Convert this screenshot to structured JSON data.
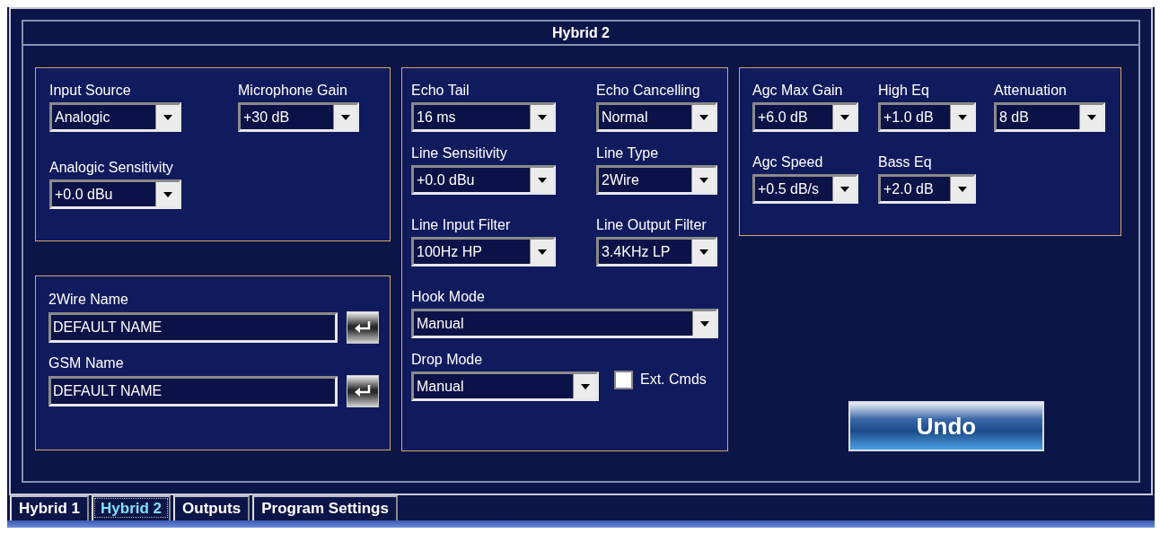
{
  "panel_title": "Hybrid 2",
  "groups": [
    {
      "rows": [
        [
          {
            "kind": "dropdown",
            "label": "Input Source",
            "value": "Analogic"
          },
          {
            "kind": "dropdown",
            "label": "Microphone Gain",
            "value": "+30 dB"
          }
        ],
        [
          {
            "kind": "dropdown",
            "label": "Analogic Sensitivity",
            "value": "+0.0 dBu"
          }
        ]
      ]
    },
    {
      "rows": [
        [
          {
            "kind": "name_input",
            "label": "2Wire Name",
            "value": "DEFAULT NAME"
          }
        ],
        [
          {
            "kind": "name_input",
            "label": "GSM Name",
            "value": "DEFAULT NAME"
          }
        ]
      ]
    },
    {
      "rows": [
        [
          {
            "kind": "dropdown",
            "label": "Echo Tail",
            "value": "16 ms"
          },
          {
            "kind": "dropdown",
            "label": "Echo Cancelling",
            "value": "Normal"
          }
        ],
        [
          {
            "kind": "dropdown",
            "label": "Line Sensitivity",
            "value": "+0.0 dBu"
          },
          {
            "kind": "dropdown",
            "label": "Line Type",
            "value": "2Wire"
          }
        ],
        [
          {
            "kind": "dropdown",
            "label": "Line Input Filter",
            "value": "100Hz HP"
          },
          {
            "kind": "dropdown",
            "label": "Line Output Filter",
            "value": "3.4KHz LP"
          }
        ],
        [
          {
            "kind": "dropdown",
            "label": "Hook Mode",
            "value": "Manual"
          }
        ],
        [
          {
            "kind": "dropdown",
            "label": "Drop Mode",
            "value": "Manual"
          },
          {
            "kind": "checkbox",
            "label": "Ext. Cmds",
            "checked": false
          }
        ]
      ]
    },
    {
      "rows": [
        [
          {
            "kind": "dropdown",
            "label": "Agc Max Gain",
            "value": "+6.0 dB"
          },
          {
            "kind": "dropdown",
            "label": "High Eq",
            "value": "+1.0 dB"
          },
          {
            "kind": "dropdown",
            "label": "Attenuation",
            "value": "8 dB"
          }
        ],
        [
          {
            "kind": "dropdown",
            "label": "Agc Speed",
            "value": "+0.5 dB/s"
          },
          {
            "kind": "dropdown",
            "label": "Bass Eq",
            "value": "+2.0 dB"
          }
        ]
      ]
    }
  ],
  "undo_button": "Undo",
  "tabs": [
    {
      "label": "Hybrid 1",
      "selected": false
    },
    {
      "label": "Hybrid 2",
      "selected": true
    },
    {
      "label": "Outputs",
      "selected": false
    },
    {
      "label": "Program Settings",
      "selected": false
    }
  ]
}
